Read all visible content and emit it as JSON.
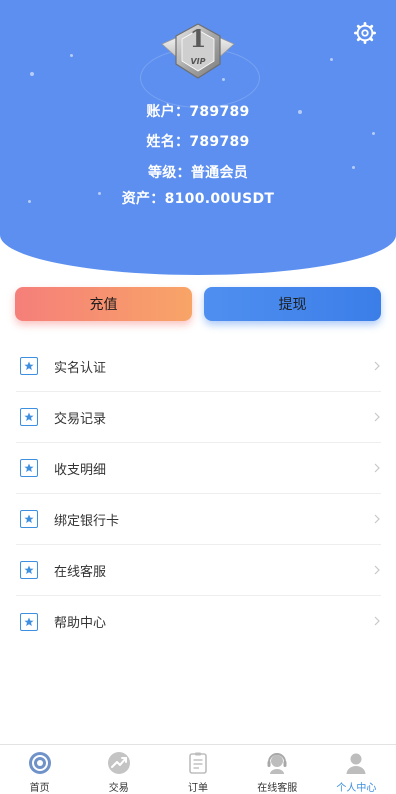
{
  "profile": {
    "vip_number": "1",
    "vip_text": "VIP",
    "account_label": "账户：",
    "account_value": "789789",
    "name_label": "姓名：",
    "name_value": "789789",
    "level_label": "等级：",
    "level_value": "普通会员",
    "assets_label": "资产：",
    "assets_value": "8100.00USDT"
  },
  "actions": {
    "recharge_label": "充值",
    "withdraw_label": "提现"
  },
  "menu": {
    "items": [
      {
        "label": "实名认证",
        "icon": "star-icon"
      },
      {
        "label": "交易记录",
        "icon": "star-icon"
      },
      {
        "label": "收支明细",
        "icon": "star-icon"
      },
      {
        "label": "绑定银行卡",
        "icon": "star-icon"
      },
      {
        "label": "在线客服",
        "icon": "star-icon"
      },
      {
        "label": "帮助中心",
        "icon": "star-icon"
      }
    ]
  },
  "tabbar": {
    "items": [
      {
        "label": "首页",
        "icon": "home-icon"
      },
      {
        "label": "交易",
        "icon": "trade-icon"
      },
      {
        "label": "订单",
        "icon": "order-icon"
      },
      {
        "label": "在线客服",
        "icon": "customer-service-icon"
      },
      {
        "label": "个人中心",
        "icon": "profile-icon",
        "active": true
      }
    ]
  },
  "colors": {
    "header_bg": "#5c8ff0",
    "accent": "#3d8fe0",
    "recharge_start": "#f57f7a",
    "recharge_end": "#f8a467",
    "withdraw_start": "#4f8ff0",
    "withdraw_end": "#3b7ee8"
  }
}
